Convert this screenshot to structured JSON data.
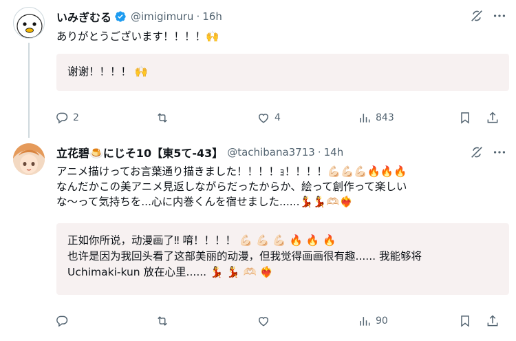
{
  "tweets": [
    {
      "name": "いみぎむる",
      "handle": "@imigimuru",
      "time": "16h",
      "text": "ありがとうございます！！！！🙌",
      "translation": "谢谢！！！！ 🙌",
      "replies": "2",
      "retweets": "",
      "likes": "4",
      "views": "843",
      "verified": true
    },
    {
      "name": "立花碧🍮にじそ10【東5て-43】",
      "handle": "@tachibana3713",
      "time": "14h",
      "text_lines": [
        "アニメ描けってお言葉通り描きました！！！！ｮ！！！！💪🏻💪🏻💪🏻🔥🔥🔥",
        "なんだかこの美アニメ見返しながらだったからか、絵って創作って楽しい",
        "な〜って気持ちを...心に内巻くんを宿せました......💃💃🫶🏻❤️‍🔥"
      ],
      "translation_lines": [
        "正如你所说，动漫画了‼ 唷！！！！ 💪🏻 💪🏻 💪🏻 🔥 🔥 🔥",
        "也许是因为我回头看了这部美丽的动漫，但我觉得画画很有趣...... 我能够将",
        "Uchimaki-kun 放在心里...... 💃 💃 🫶🏻 ❤️‍🔥"
      ],
      "replies": "",
      "retweets": "",
      "likes": "",
      "views": "90",
      "verified": false
    }
  ],
  "icons": [
    "reply-icon",
    "retweet-icon",
    "like-icon",
    "views-icon",
    "bookmark-icon",
    "share-icon",
    "grok-icon",
    "more-icon",
    "verified-icon"
  ],
  "colors": {
    "text": "#0f1419",
    "secondary": "#536471",
    "verified": "#1d9bf0",
    "translation_bg": "#f7f1f1",
    "thread_line": "#cfd9de"
  }
}
